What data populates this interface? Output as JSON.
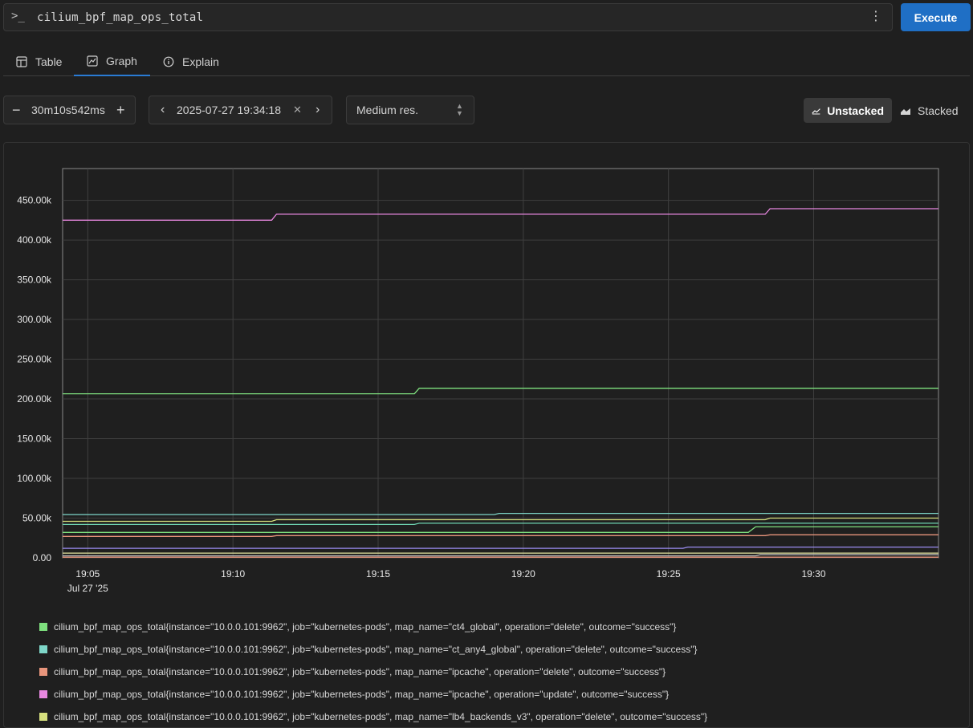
{
  "query": {
    "prompt_icon": "terminal-prompt-icon",
    "text": "cilium_bpf_map_ops_total",
    "menu_icon": "kebab-menu-icon",
    "execute_label": "Execute"
  },
  "tabs": [
    {
      "label": "Table",
      "icon": "table-icon",
      "active": false
    },
    {
      "label": "Graph",
      "icon": "graph-icon",
      "active": true
    },
    {
      "label": "Explain",
      "icon": "info-icon",
      "active": false
    }
  ],
  "controls": {
    "range": "30m10s542ms",
    "end_time": "2025-07-27 19:34:18",
    "resolution": "Medium res.",
    "unstacked_label": "Unstacked",
    "stacked_label": "Stacked"
  },
  "colors": {
    "accent": "#1f6fc5",
    "grid": "#3f3f3f"
  },
  "chart_data": {
    "type": "line",
    "yticks": [
      "0.00",
      "50.00k",
      "100.00k",
      "150.00k",
      "200.00k",
      "250.00k",
      "300.00k",
      "350.00k",
      "400.00k",
      "450.00k"
    ],
    "ylim": [
      0,
      490000
    ],
    "xticks": [
      "19:05",
      "19:10",
      "19:15",
      "19:20",
      "19:25",
      "19:30"
    ],
    "x_date_label": "Jul 27 '25",
    "x_range": [
      "19:04:08",
      "19:34:18"
    ],
    "series": [
      {
        "name": "cilium_bpf_map_ops_total{instance=\"10.0.0.101:9962\", job=\"kubernetes-pods\", map_name=\"ct4_global\", operation=\"delete\", outcome=\"success\"}",
        "color": "#7ee07e",
        "x": [
          "19:04:08",
          "19:16:15",
          "19:16:25",
          "19:34:18"
        ],
        "y": [
          206500,
          206500,
          213500,
          213500
        ]
      },
      {
        "name": "cilium_bpf_map_ops_total{instance=\"10.0.0.101:9962\", job=\"kubernetes-pods\", map_name=\"ct_any4_global\", operation=\"delete\", outcome=\"success\"}",
        "color": "#7ed6c8",
        "x": [
          "19:04:08",
          "19:19:00",
          "19:19:10",
          "19:34:18"
        ],
        "y": [
          54500,
          54500,
          56000,
          56000
        ]
      },
      {
        "name": "cilium_bpf_map_ops_total{instance=\"10.0.0.101:9962\", job=\"kubernetes-pods\", map_name=\"ipcache\", operation=\"delete\", outcome=\"success\"}",
        "color": "#e8957c",
        "x": [
          "19:04:08",
          "19:11:20",
          "19:11:30",
          "19:28:20",
          "19:28:30",
          "19:34:18"
        ],
        "y": [
          27000,
          27000,
          28000,
          28000,
          29000,
          29000
        ]
      },
      {
        "name": "cilium_bpf_map_ops_total{instance=\"10.0.0.101:9962\", job=\"kubernetes-pods\", map_name=\"ipcache\", operation=\"update\", outcome=\"success\"}",
        "color": "#e887e0",
        "x": [
          "19:04:08",
          "19:11:20",
          "19:11:30",
          "19:28:20",
          "19:28:30",
          "19:34:18"
        ],
        "y": [
          425000,
          425000,
          432500,
          432500,
          439500,
          439500
        ]
      },
      {
        "name": "cilium_bpf_map_ops_total{instance=\"10.0.0.101:9962\", job=\"kubernetes-pods\", map_name=\"lb4_backends_v3\", operation=\"delete\", outcome=\"success\"}",
        "color": "#d6e07e",
        "x": [
          "19:04:08",
          "19:11:20",
          "19:11:30",
          "19:28:20",
          "19:28:30",
          "19:34:18"
        ],
        "y": [
          46000,
          46000,
          48000,
          48000,
          50000,
          50000
        ]
      }
    ],
    "unlabeled_series": [
      {
        "color": "#6ed3b0",
        "x": [
          "19:04:08",
          "19:16:15",
          "19:16:25",
          "19:34:18"
        ],
        "y": [
          42000,
          42000,
          43500,
          43500
        ]
      },
      {
        "color": "#7ee07e",
        "x": [
          "19:04:08",
          "19:27:45",
          "19:28:00",
          "19:34:18"
        ],
        "y": [
          32000,
          32000,
          39000,
          39000
        ]
      },
      {
        "color": "#9a8cf0",
        "x": [
          "19:04:08",
          "19:25:30",
          "19:25:40",
          "19:34:18"
        ],
        "y": [
          12000,
          12000,
          13500,
          13500
        ]
      },
      {
        "color": "#e6e6a0",
        "x": [
          "19:04:08",
          "19:34:18"
        ],
        "y": [
          6000,
          6000
        ]
      },
      {
        "color": "#c0c0c0",
        "x": [
          "19:04:08",
          "19:28:00",
          "19:28:10",
          "19:34:18"
        ],
        "y": [
          2500,
          2500,
          4000,
          4000
        ]
      },
      {
        "color": "#e8957c",
        "x": [
          "19:04:08",
          "19:34:18"
        ],
        "y": [
          800,
          800
        ]
      }
    ]
  }
}
